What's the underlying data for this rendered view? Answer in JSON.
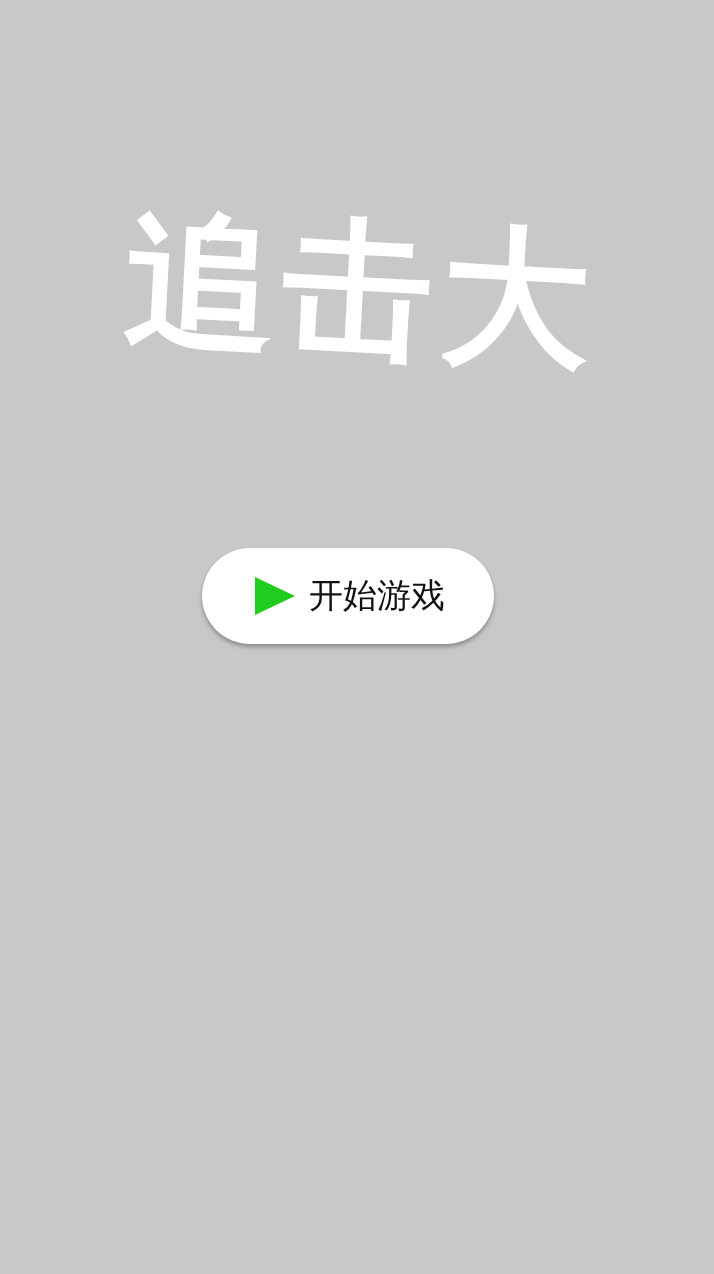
{
  "title": "追击大",
  "start_button": {
    "label": "开始游戏"
  }
}
